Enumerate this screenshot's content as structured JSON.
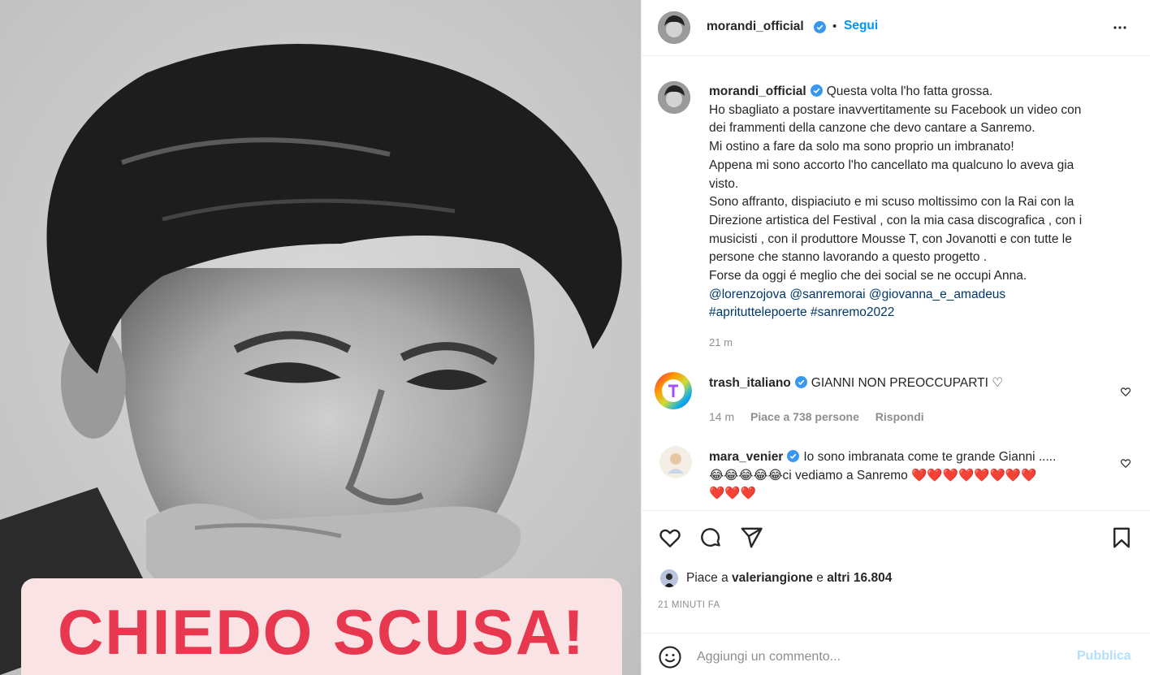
{
  "photo": {
    "overlay_text": "CHIEDO SCUSA!"
  },
  "header": {
    "username": "morandi_official",
    "separator": "•",
    "follow_label": "Segui",
    "avatar_icon": "user-avatar",
    "more_icon": "more-horizontal-icon"
  },
  "caption": {
    "username": "morandi_official",
    "first_line": "Questa volta l'ho fatta grossa.",
    "lines": [
      "Ho sbagliato a postare inavvertitamente su Facebook un video con",
      "dei frammenti della canzone che devo cantare a Sanremo.",
      "Mi ostino a fare da solo ma sono proprio un imbranato!",
      "Appena mi sono accorto l'ho cancellato ma qualcuno lo aveva gia",
      "visto.",
      "Sono affranto, dispiaciuto e mi scuso moltissimo con la Rai con la",
      "Direzione artistica del Festival , con la mia casa discografica , con i",
      "musicisti , con il produttore Mousse T, con Jovanotti e con tutte le",
      "persone che stanno lavorando a questo progetto .",
      "Forse da oggi é meglio che dei social se ne occupi Anna."
    ],
    "mentions": [
      "@lorenzojova",
      "@sanremorai",
      "@giovanna_e_amadeus"
    ],
    "hashtags": [
      "#aprituttelepoerte",
      "#sanremo2022"
    ],
    "time": "21 m"
  },
  "comments": [
    {
      "username": "trash_italiano",
      "text": "GIANNI NON PREOCCUPARTI ♡",
      "time": "14 m",
      "likes": "Piace a 738 persone",
      "reply": "Rispondi"
    },
    {
      "username": "mara_venier",
      "text_line1": "Io sono imbranata come te grande Gianni .....",
      "text_line2": "😂😂😂😂😂ci vediamo a Sanremo ❤️❤️❤️❤️❤️❤️❤️❤️",
      "text_line3": "❤️❤️❤️"
    }
  ],
  "actions": {
    "like_icon": "heart-icon",
    "comment_icon": "comment-bubble-icon",
    "share_icon": "send-icon",
    "save_icon": "bookmark-icon"
  },
  "likes": {
    "prefix": "Piace a ",
    "user": "valeriangione",
    "middle": " e ",
    "count": "altri 16.804"
  },
  "date": "21 MINUTI FA",
  "add_comment": {
    "placeholder": "Aggiungi un commento...",
    "publish_label": "Pubblica"
  },
  "colors": {
    "accent": "#0095f6",
    "caption_red": "#e8384f",
    "caption_bg": "#f9e3e4",
    "link": "#00376b",
    "muted": "#8e8e8e"
  }
}
